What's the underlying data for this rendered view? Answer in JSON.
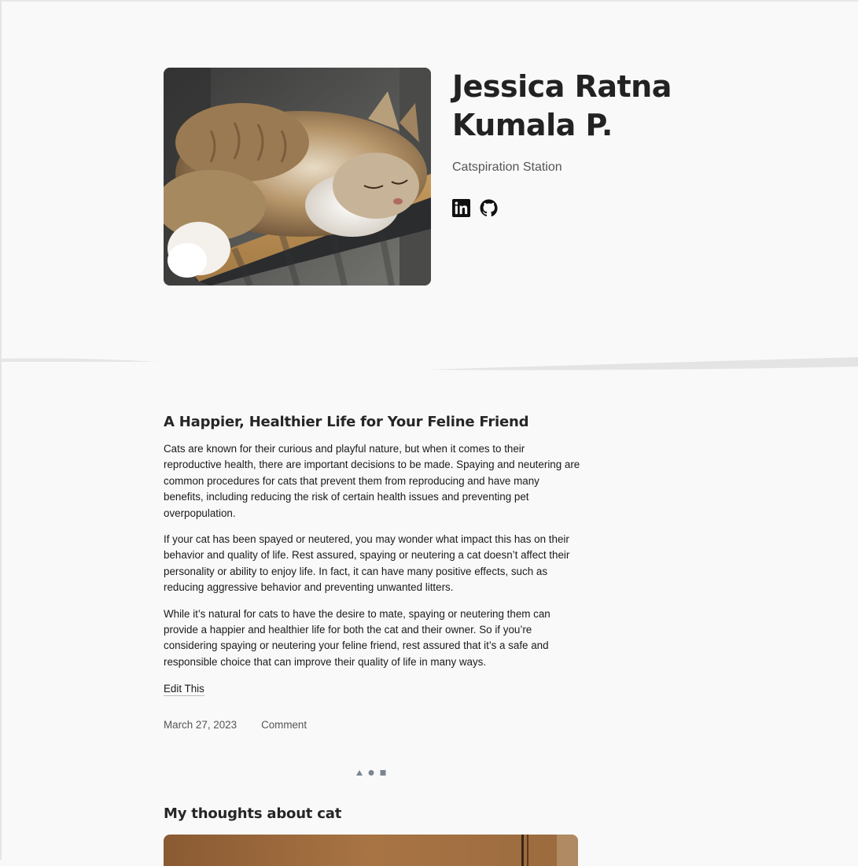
{
  "site": {
    "title": "Jessica Ratna Kumala P.",
    "tagline": "Catspiration Station",
    "hero_image": "photo of a fluffy long-haired tabby cat sleeping on a wooden table",
    "social": [
      {
        "icon": "linkedin-icon",
        "label": "LinkedIn"
      },
      {
        "icon": "github-icon",
        "label": "GitHub"
      }
    ]
  },
  "post": {
    "title": "A Happier, Healthier Life for Your Feline Friend",
    "paragraphs": [
      "Cats are known for their curious and playful nature, but when it comes to their reproductive health, there are important decisions to be made. Spaying and neutering are common procedures for cats that prevent them from reproducing and have many benefits, including reducing the risk of certain health issues and preventing pet overpopulation.",
      "If your cat has been spayed or neutered, you may wonder what impact this has on their behavior and quality of life. Rest assured, spaying or neutering a cat doesn’t affect their personality or ability to enjoy life. In fact, it can have many positive effects, such as reducing aggressive behavior and preventing unwanted litters.",
      "While it’s natural for cats to have the desire to mate, spaying or neutering them can provide a happier and healthier life for both the cat and their owner. So if you’re considering spaying or neutering your feline friend, rest assured that it’s a safe and responsible choice that can improve their quality of life in many ways."
    ],
    "edit_label": "Edit This",
    "date": "March 27, 2023",
    "comment_label": "Comment"
  },
  "next_post": {
    "title": "My thoughts about cat",
    "image": "photo with wooden background"
  },
  "colors": {
    "background": "#f9f9f9",
    "text": "#1a1a1a",
    "muted": "#555555",
    "separator": "#7a8592"
  }
}
